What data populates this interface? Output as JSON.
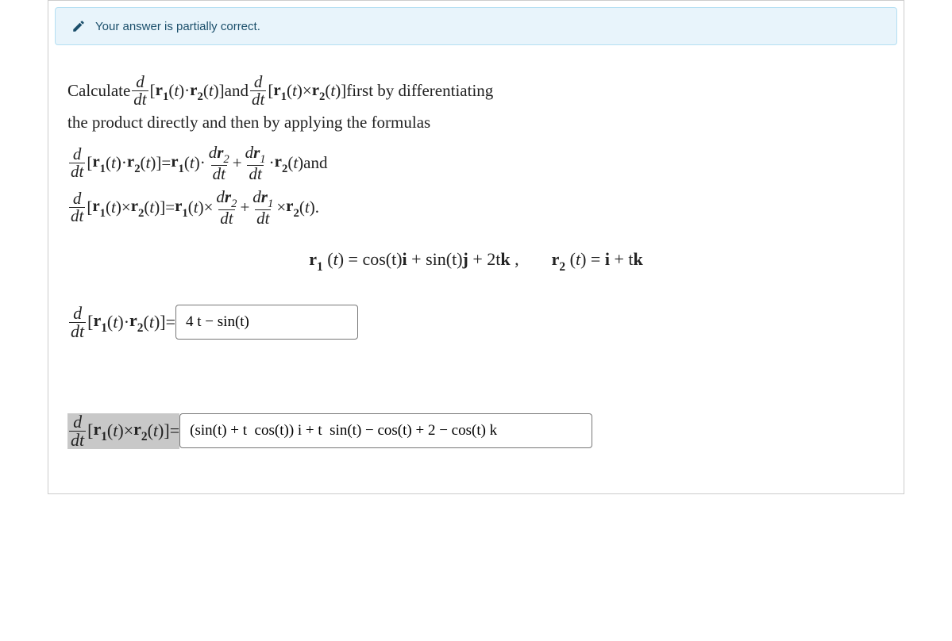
{
  "feedback": {
    "text": "Your answer is partially correct."
  },
  "intro": {
    "p1_a": "Calculate ",
    "p1_b": " and ",
    "p1_c": " first by differentiating",
    "p2": "the product directly and then by applying the formulas"
  },
  "syms": {
    "d": "d",
    "dt": "dt",
    "dr1": "dr",
    "one": "1",
    "two": "2",
    "r": "r",
    "t": "t",
    "i": "i",
    "j": "j",
    "k": "k",
    "plus": " + ",
    "eq": " = ",
    "dot": " · ",
    "cross": " × ",
    "open": "[",
    "close": "]",
    "paren_o": "(",
    "paren_c": ")",
    "and": " and",
    "period": ".",
    "comma": ",",
    "lbr": "[",
    "rbr": "]"
  },
  "formula_dot_tail": " and",
  "formula_cross_tail": ".",
  "given": {
    "r1": "cos(t)",
    "r1b": " + sin(t)",
    "r1c": " + 2t",
    "r2a": " + t",
    "sep": ",    "
  },
  "answers": {
    "a1_value": "4 t − sin(t)",
    "a2_value": "(sin(t) + t  cos(t)) i + t  sin(t) − cos(t) + 2 − cos(t) k"
  }
}
